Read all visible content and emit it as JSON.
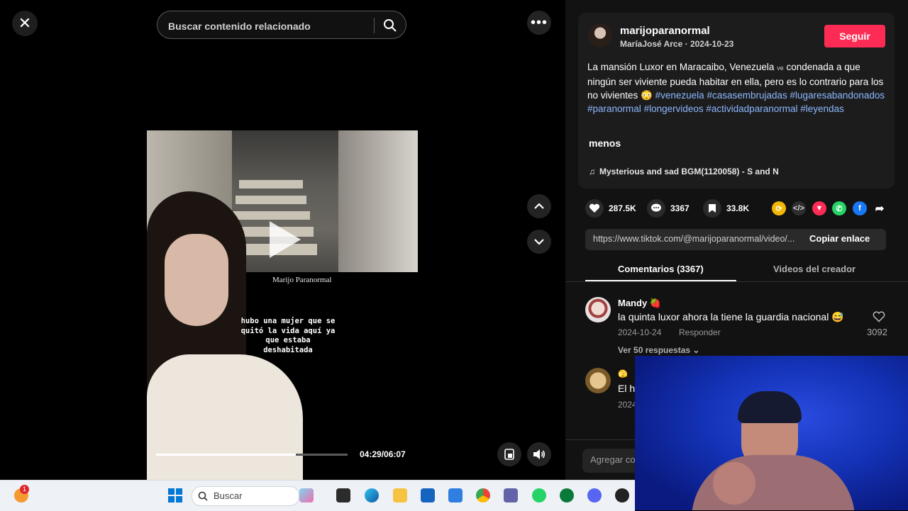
{
  "search": {
    "placeholder": "Buscar contenido relacionado"
  },
  "video": {
    "watermark": "Marijo Paranormal",
    "caption_lines": [
      "hubo una mujer que se",
      "quitó la vida aquí ya",
      "que estaba",
      "deshabitada"
    ],
    "time": "04:29/06:07",
    "progress": 0.73
  },
  "author": {
    "username": "marijoparanormal",
    "display_name": "MaríaJosé Arce",
    "date": "2024-10-23",
    "follow_label": "Seguir"
  },
  "description": {
    "text_part1": "La mansión Luxor en Maracaibo, Venezuela ",
    "flag": "ve",
    "text_part2": " condenada a que ningún ser viviente pueda habitar en ella, pero es lo contrario para los no vivientes ",
    "emoji": "😳",
    "hashtags": [
      "#venezuela",
      "#casasembrujadas",
      "#lugaresabandonados",
      "#paranormal",
      "#longervideos",
      "#actividadparanormal",
      "#leyendas"
    ],
    "less_label": "menos"
  },
  "music": {
    "icon": "music-note-icon",
    "title": "Mysterious and sad BGM(1120058) - S and N"
  },
  "stats": {
    "likes": "287.5K",
    "comments": "3367",
    "saves": "33.8K"
  },
  "share": {
    "link": "https://www.tiktok.com/@marijoparanormal/video/...",
    "copy_label": "Copiar enlace"
  },
  "tabs": [
    {
      "label": "Comentarios (3367)",
      "active": true
    },
    {
      "label": "Videos del creador",
      "active": false
    }
  ],
  "comments": [
    {
      "name": "Mandy",
      "name_emoji": "🍓",
      "text": "la quinta luxor ahora la tiene la guardia nacional",
      "text_emoji": "😅",
      "date": "2024-10-24",
      "reply_label": "Responder",
      "likes": "3092",
      "replies_label": "Ver 50 respuestas"
    },
    {
      "name_emoji": "🫣",
      "text": "El h",
      "date": "2024"
    }
  ],
  "add_comment": {
    "placeholder": "Agregar co"
  },
  "taskbar": {
    "search_label": "Buscar",
    "badge_count": "1"
  },
  "colors": {
    "accent": "#fe2c55",
    "hashtag": "#8cb8ff",
    "panel": "#121212"
  }
}
